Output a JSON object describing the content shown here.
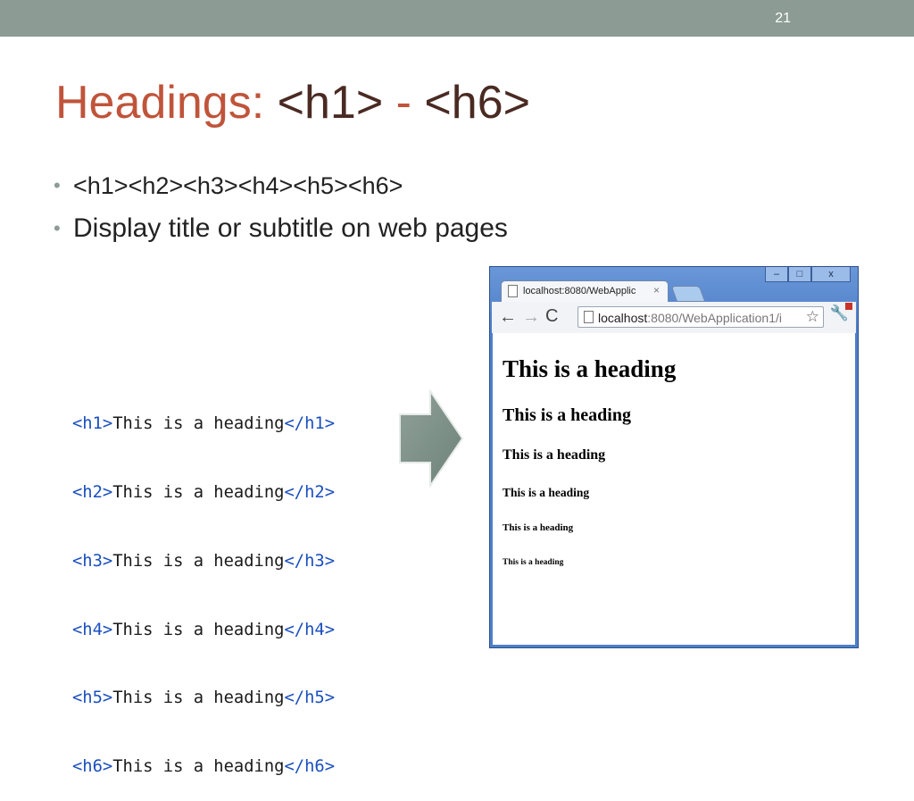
{
  "slide": {
    "number": "21"
  },
  "title": {
    "main": "Headings: ",
    "tag_open": "<h1>",
    "dash": " - ",
    "tag_close": "<h6>"
  },
  "bullets": [
    "<h1><h2><h3><h4><h5><h6>",
    "Display title or subtitle on web pages"
  ],
  "code_lines": [
    {
      "open": "<h1>",
      "text": "This is a heading",
      "close": "</h1>"
    },
    {
      "open": "<h2>",
      "text": "This is a heading",
      "close": "</h2>"
    },
    {
      "open": "<h3>",
      "text": "This is a heading",
      "close": "</h3>"
    },
    {
      "open": "<h4>",
      "text": "This is a heading",
      "close": "</h4>"
    },
    {
      "open": "<h5>",
      "text": "This is a heading",
      "close": "</h5>"
    },
    {
      "open": "<h6>",
      "text": "This is a heading",
      "close": "</h6>"
    }
  ],
  "browser": {
    "tab_title": "localhost:8080/WebApplic",
    "tab_close": "×",
    "url_host": "localhost",
    "url_path": ":8080/WebApplication1/i",
    "window_buttons": {
      "minimize": "–",
      "maximize": "□",
      "close": "x"
    },
    "nav": {
      "back": "←",
      "forward": "→",
      "reload": "C"
    },
    "headings": [
      "This is a heading",
      "This is a heading",
      "This is a heading",
      "This is a heading",
      "This is a heading",
      "This is a heading"
    ]
  },
  "colors": {
    "accent": "#c0543a",
    "topbar": "#8c9b93",
    "code_tag": "#1a4fbf",
    "arrow": "#7d8f86"
  },
  "icons": [
    "arrow-right-icon",
    "page-icon",
    "star-icon",
    "wrench-icon",
    "back-arrow-icon",
    "forward-arrow-icon",
    "reload-icon"
  ]
}
